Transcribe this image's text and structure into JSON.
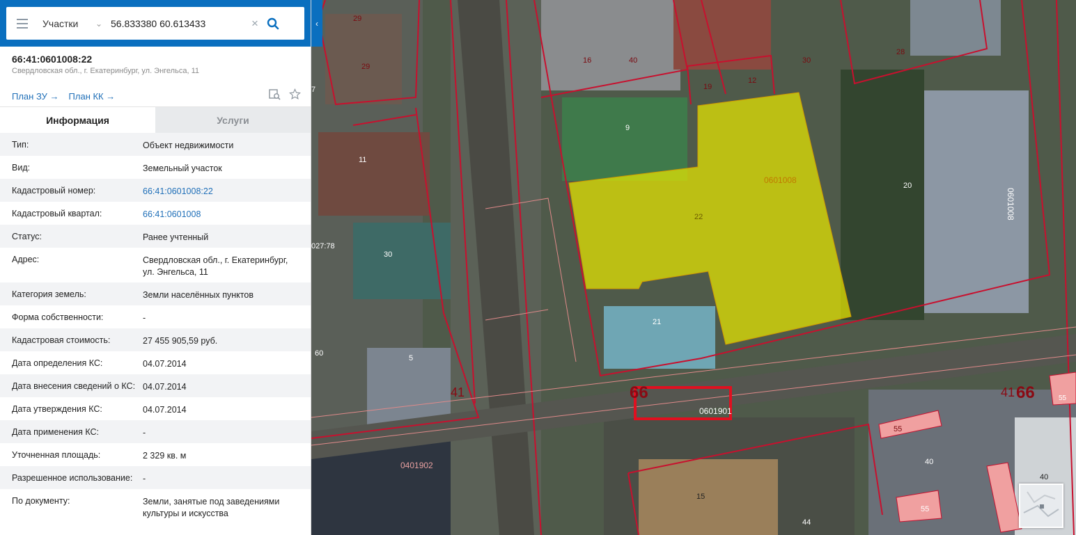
{
  "search": {
    "layer": "Участки",
    "query": "56.833380 60.613433"
  },
  "object": {
    "cadastral_number": "66:41:0601008:22",
    "address_short": "Свердловская обл., г. Екатеринбург, ул. Энгельса, 11",
    "link_plan_zu": "План ЗУ →",
    "link_plan_kk": "План КК →"
  },
  "tabs": [
    {
      "label": "Информация",
      "active": true
    },
    {
      "label": "Услуги",
      "active": false
    }
  ],
  "info_rows": [
    {
      "label": "Тип:",
      "value": "Объект недвижимости"
    },
    {
      "label": "Вид:",
      "value": "Земельный участок"
    },
    {
      "label": "Кадастровый номер:",
      "value": "66:41:0601008:22",
      "link": true
    },
    {
      "label": "Кадастровый квартал:",
      "value": "66:41:0601008",
      "link": true
    },
    {
      "label": "Статус:",
      "value": "Ранее учтенный"
    },
    {
      "label": "Адрес:",
      "value": "Свердловская обл., г. Екатеринбург, ул. Энгельса, 11"
    },
    {
      "label": "Категория земель:",
      "value": "Земли населённых пунктов"
    },
    {
      "label": "Форма собственности:",
      "value": "-"
    },
    {
      "label": "Кадастровая стоимость:",
      "value": "27 455 905,59 руб."
    },
    {
      "label": "Дата определения КС:",
      "value": "04.07.2014"
    },
    {
      "label": "Дата внесения сведений о КС:",
      "value": "04.07.2014"
    },
    {
      "label": "Дата утверждения КС:",
      "value": "04.07.2014"
    },
    {
      "label": "Дата применения КС:",
      "value": "-"
    },
    {
      "label": "Уточненная площадь:",
      "value": "2 329 кв. м"
    },
    {
      "label": "Разрешенное использование:",
      "value": "-"
    },
    {
      "label": "По документу:",
      "value": "Земли, занятые под заведениями культуры и искусства"
    }
  ],
  "map": {
    "parcel_labels": [
      "29",
      "29",
      "16",
      "40",
      "30",
      "28",
      "19",
      "12",
      "9",
      "11",
      "22",
      "20",
      "30",
      "21",
      "60",
      "5",
      "15",
      "44",
      "55",
      "40",
      "40",
      "55",
      "027:78",
      "7"
    ],
    "quarter_labels": [
      "0601008",
      "0601008",
      "0601901",
      "0401902"
    ],
    "district_labels": [
      "41",
      "66",
      "41",
      "66",
      "55"
    ],
    "colors": {
      "parcel_line": "#c8102e",
      "selected_fill": "#e6e600",
      "highlight_box": "#e01020"
    }
  }
}
